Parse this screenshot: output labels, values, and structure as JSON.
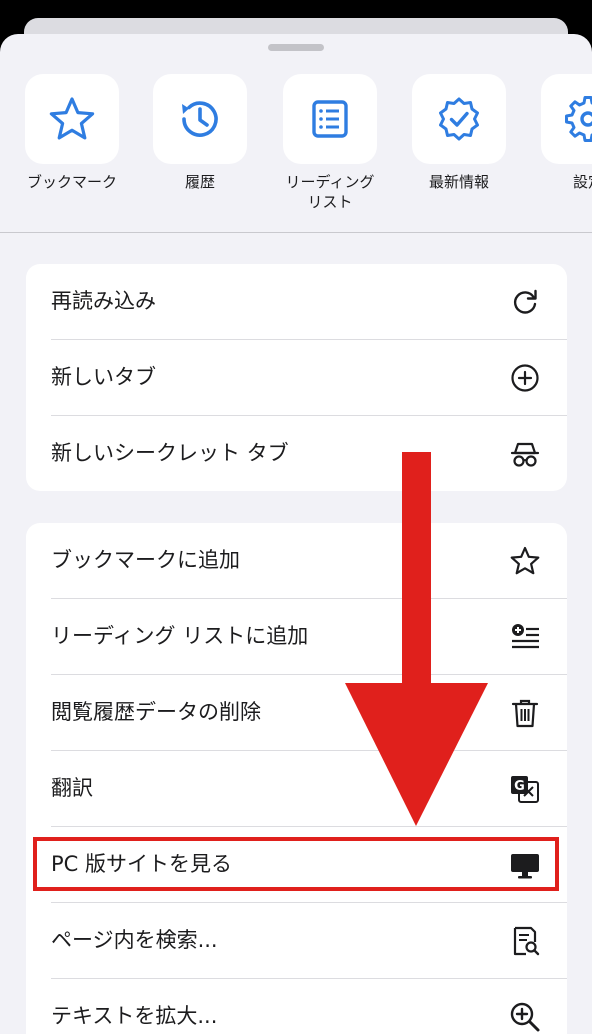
{
  "shortcuts": [
    {
      "label": "ブックマーク",
      "icon": "star-icon"
    },
    {
      "label": "履歴",
      "icon": "history-icon"
    },
    {
      "label": "リーディング\nリスト",
      "icon": "reading-list-icon"
    },
    {
      "label": "最新情報",
      "icon": "verified-badge-icon"
    },
    {
      "label": "設定",
      "icon": "gear-icon"
    }
  ],
  "group1": [
    {
      "label": "再読み込み",
      "icon": "reload-icon"
    },
    {
      "label": "新しいタブ",
      "icon": "plus-circle-icon"
    },
    {
      "label": "新しいシークレット タブ",
      "icon": "incognito-icon"
    }
  ],
  "group2": [
    {
      "label": "ブックマークに追加",
      "icon": "star-outline-icon"
    },
    {
      "label": "リーディング リストに追加",
      "icon": "add-to-list-icon"
    },
    {
      "label": "閲覧履歴データの削除",
      "icon": "trash-icon"
    },
    {
      "label": "翻訳",
      "icon": "translate-icon"
    },
    {
      "label": "PC 版サイトを見る",
      "icon": "desktop-icon"
    },
    {
      "label": "ページ内を検索...",
      "icon": "find-in-page-icon"
    },
    {
      "label": "テキストを拡大...",
      "icon": "zoom-in-icon"
    }
  ],
  "colors": {
    "accent": "#2f7de1",
    "annotation": "#e0201c",
    "sheet": "#f2f2f7"
  }
}
